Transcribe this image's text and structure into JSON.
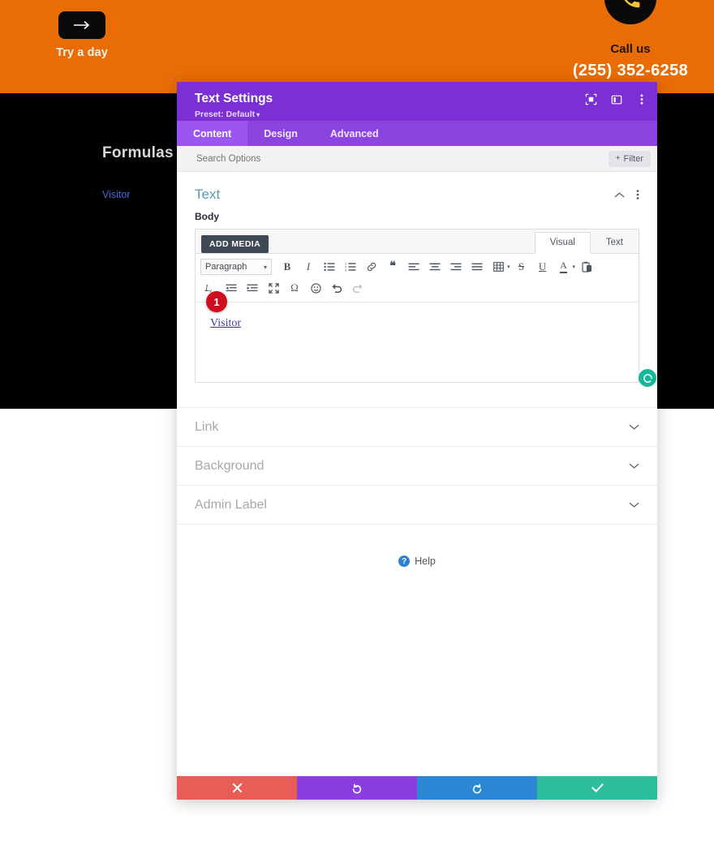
{
  "page": {
    "cta": {
      "label": "Try a day",
      "icon": "arrow-right-icon"
    },
    "call": {
      "icon": "phone-icon",
      "label": "Call us",
      "number": "(255) 352-6258"
    },
    "heading": "Formulas",
    "link": "Visitor",
    "colors": {
      "orange": "#ea6c05",
      "black": "#000000",
      "link_blue": "#4169d8"
    }
  },
  "modal": {
    "title": "Text Settings",
    "preset": "Preset: Default",
    "preset_caret": "▾",
    "header_icons": [
      {
        "name": "focus-target-icon"
      },
      {
        "name": "panel-layout-icon"
      },
      {
        "name": "kebab-menu-icon"
      }
    ],
    "tabs": [
      {
        "label": "Content",
        "active": true
      },
      {
        "label": "Design",
        "active": false
      },
      {
        "label": "Advanced",
        "active": false
      }
    ],
    "search": {
      "placeholder": "Search Options",
      "filter_label": "Filter",
      "filter_plus": "+"
    },
    "section": {
      "title": "Text",
      "collapse_icon": "chevron-up-icon",
      "menu_icon": "kebab-menu-icon"
    },
    "field": {
      "label": "Body",
      "add_media": "ADD MEDIA",
      "mode_tabs": [
        {
          "label": "Visual",
          "active": true
        },
        {
          "label": "Text",
          "active": false
        }
      ],
      "format_select": "Paragraph",
      "format_caret": "▾",
      "toolbar_row1": [
        {
          "name": "bold-icon",
          "glyph": "B"
        },
        {
          "name": "italic-icon",
          "glyph": "I"
        },
        {
          "name": "bulleted-list-icon"
        },
        {
          "name": "numbered-list-icon"
        },
        {
          "name": "link-icon"
        },
        {
          "name": "blockquote-icon",
          "glyph": "❝"
        },
        {
          "name": "align-left-icon"
        },
        {
          "name": "align-center-icon"
        },
        {
          "name": "align-right-icon"
        },
        {
          "name": "align-justify-icon"
        },
        {
          "name": "table-icon"
        },
        {
          "name": "strikethrough-icon",
          "glyph": "S"
        },
        {
          "name": "underline-icon",
          "glyph": "U"
        },
        {
          "name": "text-color-icon",
          "glyph": "A"
        },
        {
          "name": "paste-icon"
        }
      ],
      "toolbar_row2": [
        {
          "name": "clear-formatting-icon"
        },
        {
          "name": "outdent-icon"
        },
        {
          "name": "indent-icon"
        },
        {
          "name": "fullscreen-icon"
        },
        {
          "name": "special-character-icon",
          "glyph": "Ω"
        },
        {
          "name": "emoji-icon",
          "glyph": "☺"
        },
        {
          "name": "undo-icon"
        },
        {
          "name": "redo-icon"
        }
      ],
      "content": "Visitor",
      "step_badge": "1",
      "spinner_icon": "loading-spinner-icon"
    },
    "accordion": [
      {
        "label": "Link",
        "icon": "chevron-down-icon"
      },
      {
        "label": "Background",
        "icon": "chevron-down-icon"
      },
      {
        "label": "Admin Label",
        "icon": "chevron-down-icon"
      }
    ],
    "help": {
      "glyph": "?",
      "label": "Help"
    },
    "footer": [
      {
        "name": "cancel-button",
        "icon": "close-icon"
      },
      {
        "name": "undo-button",
        "icon": "undo-arrow-icon"
      },
      {
        "name": "redo-button",
        "icon": "redo-arrow-icon"
      },
      {
        "name": "save-button",
        "icon": "check-icon"
      }
    ]
  }
}
